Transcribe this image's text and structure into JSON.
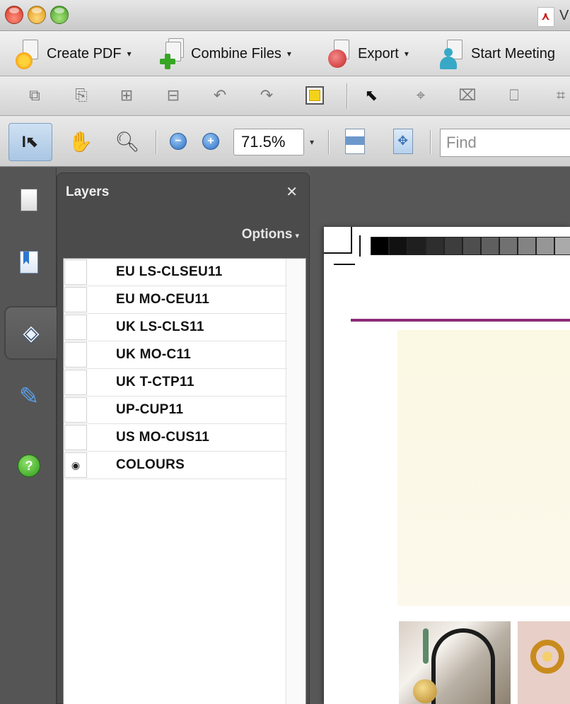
{
  "window": {
    "title_text": "V"
  },
  "tasks_toolbar": {
    "create_pdf": "Create PDF",
    "combine_files": "Combine Files",
    "export": "Export",
    "start_meeting": "Start Meeting",
    "caret": "▾"
  },
  "view_toolbar": {
    "zoom_value": "71.5%",
    "find_placeholder": "Find"
  },
  "layers_panel": {
    "title": "Layers",
    "close": "✕",
    "options_label": "Options",
    "layers": [
      {
        "name": "EU LS-CLSEU11",
        "visible": false
      },
      {
        "name": "EU MO-CEU11",
        "visible": false
      },
      {
        "name": "UK LS-CLS11",
        "visible": false
      },
      {
        "name": "UK MO-C11",
        "visible": false
      },
      {
        "name": "UK T-CTP11",
        "visible": false
      },
      {
        "name": "UP-CUP11",
        "visible": false
      },
      {
        "name": "US MO-CUS11",
        "visible": false
      },
      {
        "name": "COLOURS",
        "visible": true,
        "icon": "eye-icon"
      }
    ]
  },
  "nav_rail": {
    "help": "?"
  },
  "document": {
    "grayscale_swatches": [
      "#000000",
      "#111111",
      "#1f1f1f",
      "#2e2e2e",
      "#3d3d3d",
      "#4e4e4e",
      "#5f5f5f",
      "#717171",
      "#838383",
      "#969696",
      "#aaaaaa",
      "#c0c0c0",
      "#d6d6d6",
      "#ffffff"
    ],
    "rule_color": "#8a2b78"
  }
}
